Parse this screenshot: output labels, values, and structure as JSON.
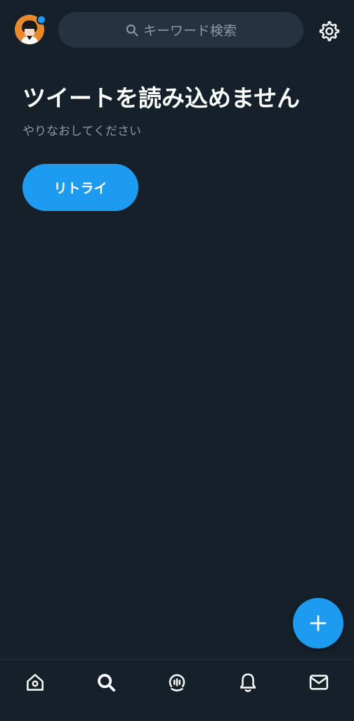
{
  "header": {
    "search": {
      "placeholder": "キーワード検索"
    }
  },
  "main": {
    "title": "ツイートを読み込めません",
    "subtitle": "やりなおしてください",
    "retry_label": "リトライ"
  },
  "colors": {
    "background": "#15202b",
    "accent": "#1d9bf0",
    "search_bg": "#253341",
    "muted_text": "#8b98a5",
    "avatar_bg": "#e8892c"
  },
  "icons": {
    "settings": "gear-icon",
    "search": "search-icon",
    "fab": "plus-icon",
    "nav": [
      "home-icon",
      "search-icon",
      "spaces-icon",
      "bell-icon",
      "mail-icon"
    ]
  }
}
